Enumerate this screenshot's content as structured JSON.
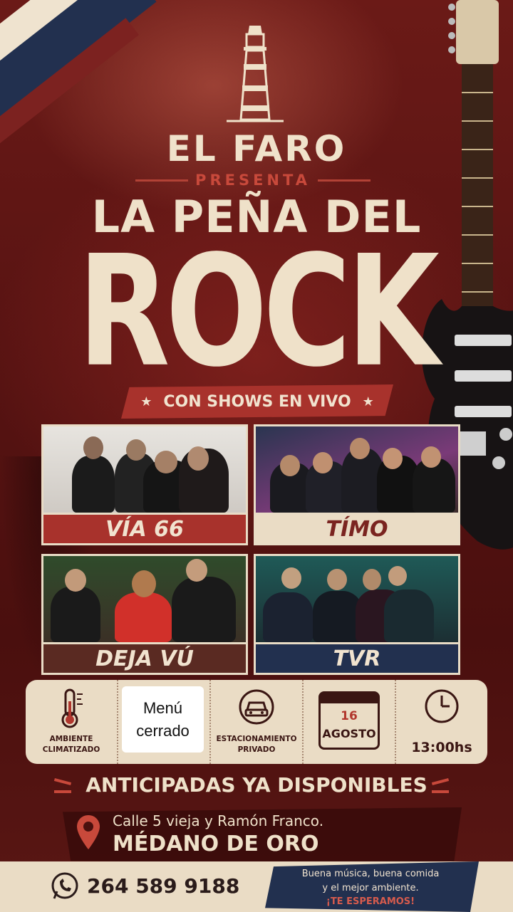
{
  "header": {
    "brand": "EL FARO",
    "presenta": "PRESENTA",
    "title_line1": "LA PEÑA DEL",
    "title_line2": "ROCK",
    "banner": "CON SHOWS EN VIVO"
  },
  "bands": [
    {
      "name": "VÍA 66"
    },
    {
      "name": "TÍMO"
    },
    {
      "name": "DEJA VÚ"
    },
    {
      "name": "TVR"
    }
  ],
  "info": {
    "ambiente": "AMBIENTE CLIMATIZADO",
    "estacionamiento": "ESTACIONAMIENTO PRIVADO",
    "date_day": "16",
    "date_month": "AGOSTO",
    "time": "13:00hs"
  },
  "overlay": {
    "line1": "Menú",
    "line2": "cerrado"
  },
  "tickets": "ANTICIPADAS YA DISPONIBLES",
  "address": {
    "street": "Calle 5 vieja y Ramón Franco.",
    "area": "MÉDANO DE ORO"
  },
  "footer": {
    "phone": "264 589 9188",
    "tagline1": "Buena música, buena comida",
    "tagline2": "y el mejor ambiente.",
    "cta": "¡TE ESPERAMOS!"
  },
  "colors": {
    "background": "#5a1412",
    "cream": "#eadcc5",
    "accent_red": "#a8322c",
    "navy": "#22304f"
  },
  "icons": [
    "lighthouse-icon",
    "guitar-graphic",
    "thermometer-icon",
    "car-icon",
    "calendar-icon",
    "clock-icon",
    "location-pin-icon",
    "whatsapp-icon"
  ]
}
